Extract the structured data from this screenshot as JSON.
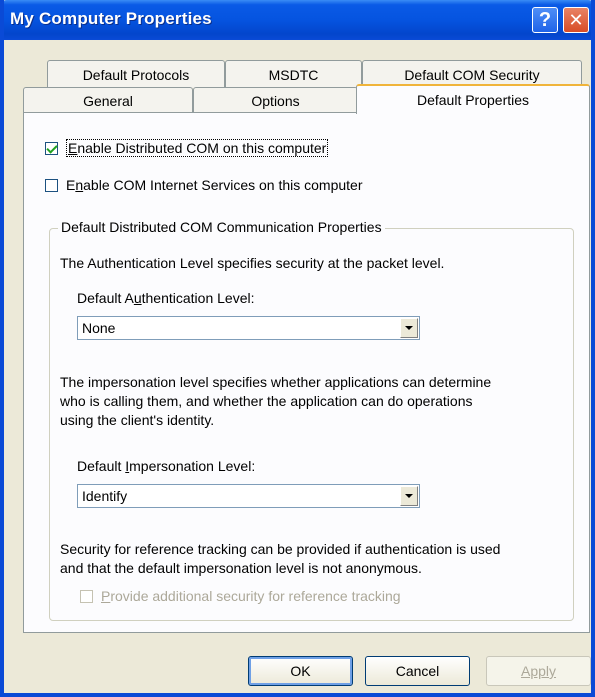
{
  "window": {
    "title": "My Computer Properties"
  },
  "title_buttons": {
    "help": "?",
    "close": "✕"
  },
  "tabs_back": [
    "Default Protocols",
    "MSDTC",
    "Default COM Security"
  ],
  "tabs_front": [
    "General",
    "Options",
    "Default Properties"
  ],
  "active_tab": "Default Properties",
  "checkbox_dcom": {
    "checked": true,
    "label_pre": "",
    "label_ul": "E",
    "label_post": "nable Distributed COM on this computer"
  },
  "checkbox_cis": {
    "checked": false,
    "label_pre": "E",
    "label_ul": "n",
    "label_post": "able COM Internet Services on this computer"
  },
  "group": {
    "title": "Default Distributed COM Communication Properties",
    "auth_desc": "The Authentication Level specifies security at the packet level.",
    "auth_label_pre": "Default A",
    "auth_label_ul": "u",
    "auth_label_post": "thentication Level:",
    "auth_value": "None",
    "imp_desc_1": "The impersonation level specifies whether applications can determine",
    "imp_desc_2": "who is calling them, and whether the application can do operations",
    "imp_desc_3": "using the client's identity.",
    "imp_label_pre": "Default ",
    "imp_label_ul": "I",
    "imp_label_post": "mpersonation Level:",
    "imp_value": "Identify",
    "ref_desc_1": "Security for reference tracking can be provided if authentication is used",
    "ref_desc_2": "and that the default impersonation level is not anonymous.",
    "ref_checkbox": {
      "checked": false,
      "enabled": false,
      "label_ul": "P",
      "label_post": "rovide additional security for reference tracking"
    }
  },
  "buttons": {
    "ok": "OK",
    "cancel": "Cancel",
    "apply": "Apply"
  }
}
